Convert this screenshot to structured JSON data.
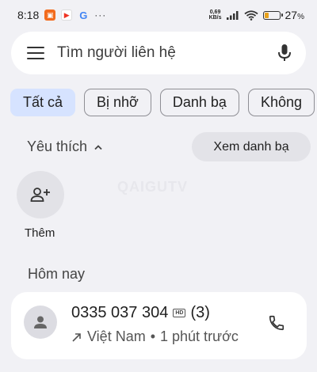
{
  "status_bar": {
    "time": "8:18",
    "net_speed_value": "0,69",
    "net_speed_unit": "KB/s",
    "battery_percent": "27",
    "battery_level": 0.27,
    "battery_color": "#e8a21c",
    "more_indicator": "···",
    "google_icon_letter": "G"
  },
  "search": {
    "placeholder": "Tìm người liên hệ"
  },
  "filters": {
    "all": "Tất cả",
    "missed": "Bị nhỡ",
    "contacts": "Danh bạ",
    "unknown": "Không"
  },
  "favorites": {
    "title": "Yêu thích",
    "view_contacts": "Xem danh bạ",
    "add_label": "Thêm"
  },
  "watermark": "QAIGUTV",
  "today": {
    "title": "Hôm nay",
    "entry": {
      "number": "0335 037 304",
      "hd_badge": "HD",
      "count": "(3)",
      "location": "Việt Nam",
      "separator": "•",
      "time": "1 phút trước"
    }
  },
  "colors": {
    "background": "#f1f1f5",
    "selected_chip": "#d6e3ff",
    "card": "#ffffff"
  }
}
